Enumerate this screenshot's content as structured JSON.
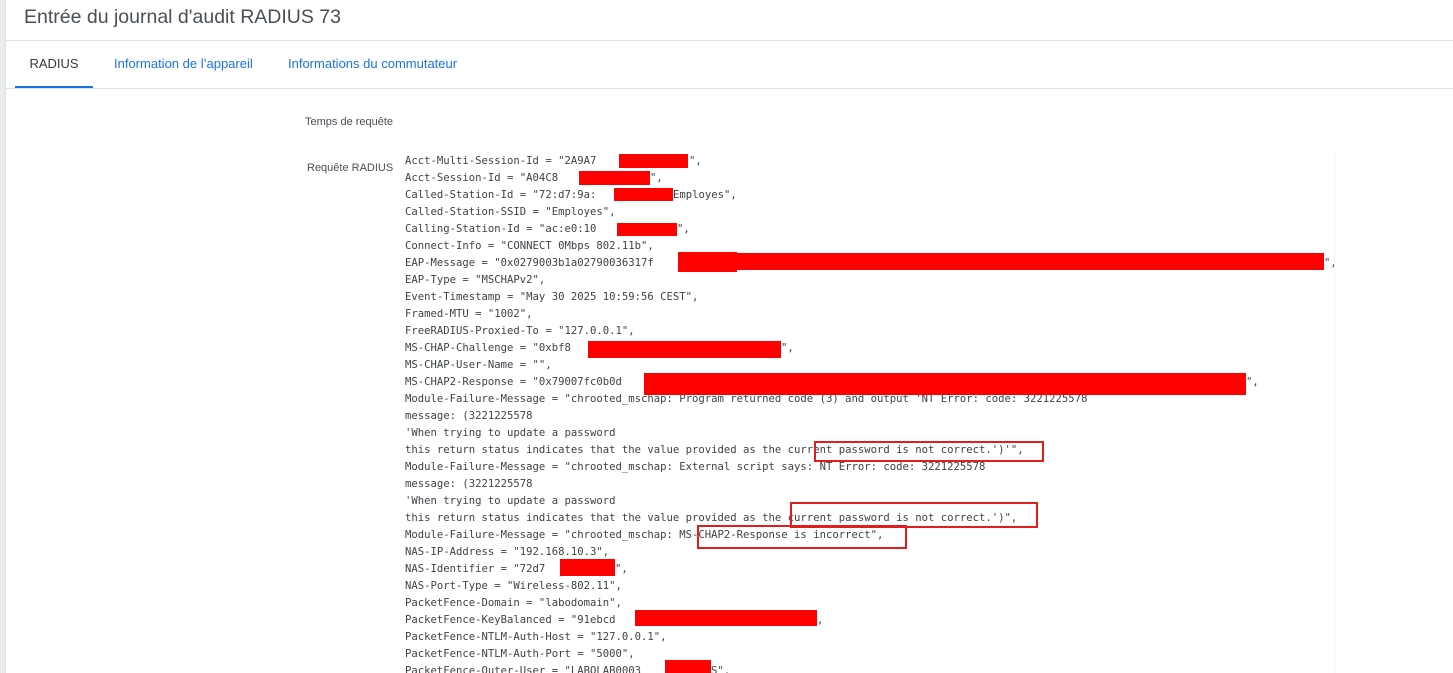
{
  "page": {
    "title": "Entrée du journal d'audit RADIUS 73"
  },
  "tabs": [
    {
      "label": "RADIUS",
      "active": true
    },
    {
      "label": "Information de l’appareil",
      "active": false
    },
    {
      "label": "Informations du commutateur",
      "active": false
    }
  ],
  "fields": {
    "request_time_label": "Temps de requête",
    "radius_request_label": "Requête RADIUS"
  },
  "radius_request": {
    "lines": [
      "Acct-Multi-Session-Id = \"2A9A7",
      "Acct-Session-Id = \"A04C8",
      "Called-Station-Id = \"72:d7:9a:",
      "Called-Station-SSID = \"Employes\",",
      "Calling-Station-Id = \"ac:e0:10",
      "Connect-Info = \"CONNECT 0Mbps 802.11b\",",
      "EAP-Message = \"0x0279003b1a02790036317f",
      "EAP-Type = \"MSCHAPv2\",",
      "Event-Timestamp = \"May 30 2025 10:59:56 CEST\",",
      "Framed-MTU = \"1002\",",
      "FreeRADIUS-Proxied-To = \"127.0.0.1\",",
      "MS-CHAP-Challenge = \"0xbf8",
      "MS-CHAP-User-Name = \"\",",
      "MS-CHAP2-Response = \"0x79007fc0b0d",
      "Module-Failure-Message = \"chrooted_mschap: Program returned code (3) and output 'NT Error: code: 3221225578",
      "message: (3221225578",
      "'When trying to update a password",
      "this return status indicates that the value provided as the current password is not correct.')'\",",
      "Module-Failure-Message = \"chrooted_mschap: External script says: NT Error: code: 3221225578",
      "message: (3221225578",
      "'When trying to update a password",
      "this return status indicates that the value provided as the current password is not correct.')\",",
      "Module-Failure-Message = \"chrooted_mschap: MS-CHAP2-Response is incorrect\",",
      "NAS-IP-Address = \"192.168.10.3\",",
      "NAS-Identifier = \"72d7",
      "NAS-Port-Type = \"Wireless-802.11\",",
      "PacketFence-Domain = \"labodomain\",",
      "PacketFence-KeyBalanced = \"91ebcd",
      "PacketFence-NTLM-Auth-Host = \"127.0.0.1\",",
      "PacketFence-NTLM-Auth-Port = \"5000\",",
      "PacketFence-Outer-User = \"LABOLAB0003"
    ],
    "line_suffixes": {
      "0": "\",",
      "1": "\",",
      "2": "Employes\",",
      "4": "\",",
      "6": "\",",
      "11": "\",",
      "13": "\",",
      "24": "\",",
      "27": ",",
      "30": "S\","
    }
  },
  "colors": {
    "redaction": "#ff0000",
    "highlight_box": "#e11d1d",
    "tab_link": "#1a73e8"
  }
}
